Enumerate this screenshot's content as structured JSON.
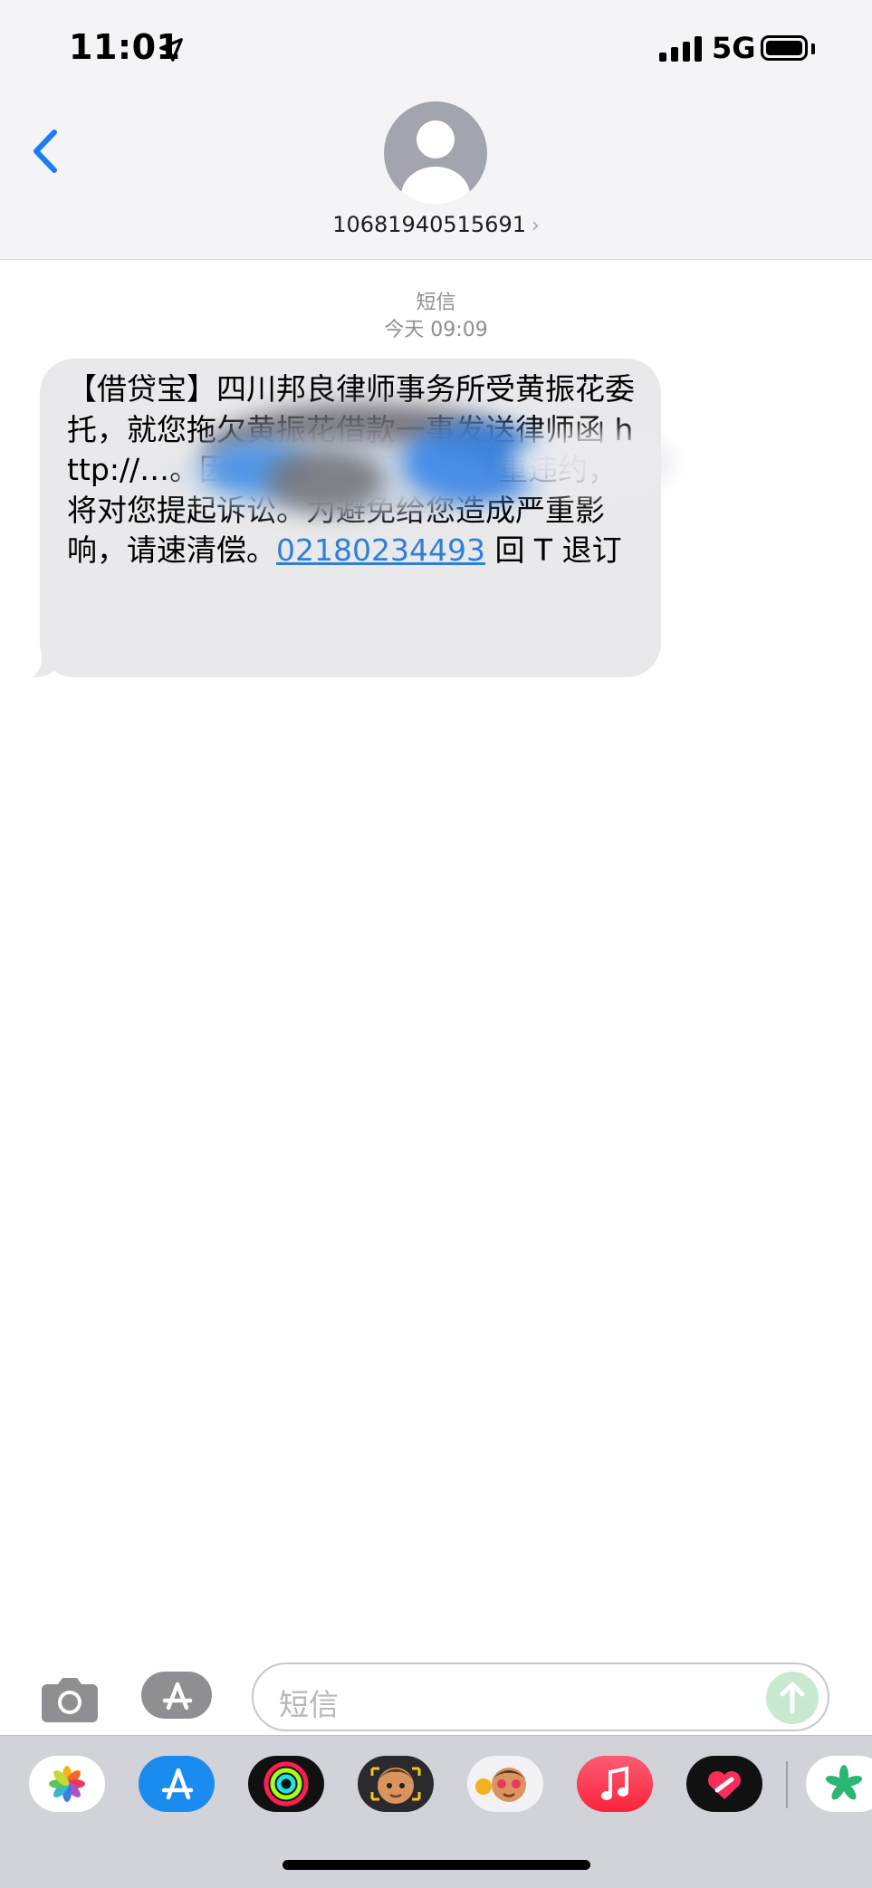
{
  "status_bar": {
    "time": "11:01",
    "network": "5G"
  },
  "header": {
    "sender": "10681940515691",
    "chevron": "›"
  },
  "conversation": {
    "service_label": "短信",
    "timestamp": "今天 09:09",
    "message": {
      "text": "【借贷宝】四川邦良律师事务所受黄振花委托，就您拖欠黄振花借款一事发送律师函 http://…。因您长期拖欠已构成严重违约，将对您提起诉讼。为避免给您造成严重影响，请速清偿。",
      "phone": "02180234493",
      "suffix": " 回 T 退订"
    }
  },
  "input_bar": {
    "placeholder": "短信"
  },
  "dock": {
    "apps": [
      "photos-app-icon",
      "app-store-app-icon",
      "activity-app-icon",
      "memoji-app-icon",
      "animoji-app-icon",
      "music-app-icon",
      "digital-touch-app-icon",
      "extension-app-icon"
    ]
  },
  "colors": {
    "accent": "#2e7fd9",
    "bubble": "#e9e9eb",
    "header": "#f4f4f6",
    "dock": "#d1d3d9",
    "send": "#c6e9d0"
  }
}
